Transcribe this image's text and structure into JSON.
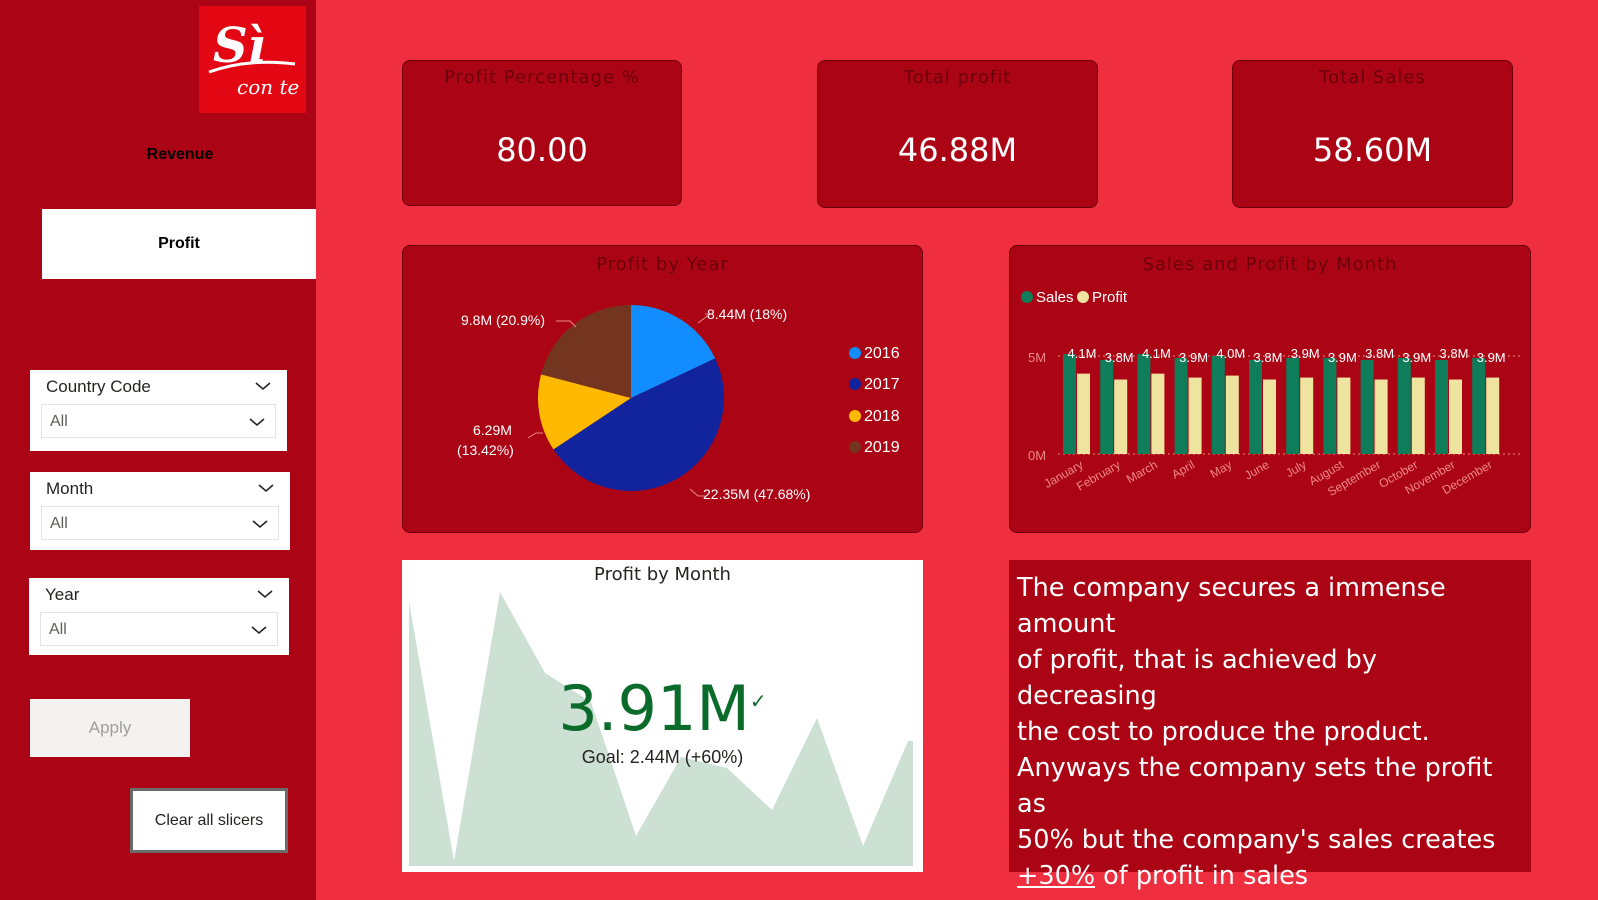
{
  "sidebar": {
    "logo_text": "Sì con te",
    "nav": {
      "revenue": "Revenue",
      "profit": "Profit"
    },
    "slicers": [
      {
        "title": "Country Code",
        "value": "All"
      },
      {
        "title": "Month",
        "value": "All"
      },
      {
        "title": "Year",
        "value": "All"
      }
    ],
    "apply_label": "Apply",
    "clear_label": "Clear all slicers"
  },
  "kpis": [
    {
      "title": "Profit Percentage %",
      "value": "80.00"
    },
    {
      "title": "Total profit",
      "value": "46.88M"
    },
    {
      "title": "Total Sales",
      "value": "58.60M"
    }
  ],
  "colors": {
    "background": "#ef2f3f",
    "panel": "#ab0515",
    "sales": "#0f7d5a",
    "profit": "#efe3a0",
    "y2016": "#118dff",
    "y2017": "#12239e",
    "y2018": "#ffb900",
    "y2019": "#733520"
  },
  "profit_by_year": {
    "title": "Profit by Year",
    "legend": [
      "2016",
      "2017",
      "2018",
      "2019"
    ],
    "labels": {
      "y2016": "8.44M (18%)",
      "y2017": "22.35M (47.68%)",
      "y2018_a": "6.29M",
      "y2018_b": "(13.42%)",
      "y2019": "9.8M (20.9%)"
    }
  },
  "sales_profit_month": {
    "title": "Sales and Profit by Month",
    "legend": {
      "sales": "Sales",
      "profit": "Profit"
    },
    "y_ticks": [
      "5M",
      "0M"
    ]
  },
  "profit_by_month": {
    "title": "Profit by Month",
    "value": "3.91M",
    "goal": "Goal: 2.44M (+60%)"
  },
  "note": {
    "line1": "The company secures a immense amount",
    "line2": "of profit, that is achieved by decreasing",
    "line3": "the cost to produce the product.",
    "line4": "Anyways the company sets the profit as",
    "line5": "50% but the company's sales creates",
    "highlight": "+30%",
    "line6_rest": " of profit in sales"
  },
  "chart_data": [
    {
      "type": "pie",
      "title": "Profit by Year",
      "categories": [
        "2016",
        "2017",
        "2018",
        "2019"
      ],
      "values": [
        8.44,
        22.35,
        6.29,
        9.8
      ],
      "percent": [
        18,
        47.68,
        13.42,
        20.9
      ],
      "unit": "M"
    },
    {
      "type": "bar",
      "title": "Sales and Profit by Month",
      "categories": [
        "January",
        "February",
        "March",
        "April",
        "May",
        "June",
        "July",
        "August",
        "September",
        "October",
        "November",
        "December"
      ],
      "series": [
        {
          "name": "Sales",
          "values": [
            5.1,
            4.8,
            5.1,
            4.9,
            5.0,
            4.8,
            4.9,
            4.9,
            4.8,
            4.9,
            4.8,
            4.9
          ]
        },
        {
          "name": "Profit",
          "values": [
            4.1,
            3.8,
            4.1,
            3.9,
            4.0,
            3.8,
            3.9,
            3.9,
            3.8,
            3.9,
            3.8,
            3.9
          ]
        }
      ],
      "data_labels": [
        "4.1M",
        "3.8M",
        "4.1M",
        "3.9M",
        "4.0M",
        "3.8M",
        "3.9M",
        "3.9M",
        "3.8M",
        "3.9M",
        "3.8M",
        "3.9M"
      ],
      "ylim": [
        0,
        5
      ],
      "y_ticks": [
        "0M",
        "5M"
      ],
      "legend": "top-left"
    }
  ]
}
